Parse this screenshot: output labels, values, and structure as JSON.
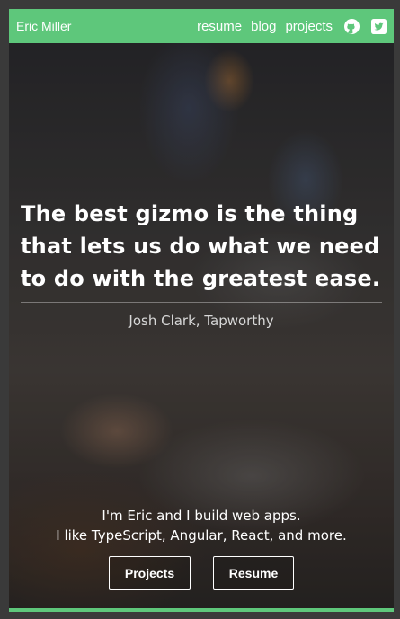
{
  "navbar": {
    "brand": "Eric Miller",
    "links": [
      {
        "label": "resume"
      },
      {
        "label": "blog"
      },
      {
        "label": "projects"
      }
    ],
    "icons": [
      "github-icon",
      "twitter-icon"
    ],
    "color": "#5ec77b"
  },
  "hero": {
    "quote": "The best gizmo is the thing that lets us do what we need to do with the greatest ease.",
    "attribution": "Josh Clark, Tapworthy",
    "intro_line1": "I'm Eric and I build web apps.",
    "intro_line2": "I like TypeScript, Angular, React, and more.",
    "buttons": {
      "projects": "Projects",
      "resume": "Resume"
    }
  }
}
